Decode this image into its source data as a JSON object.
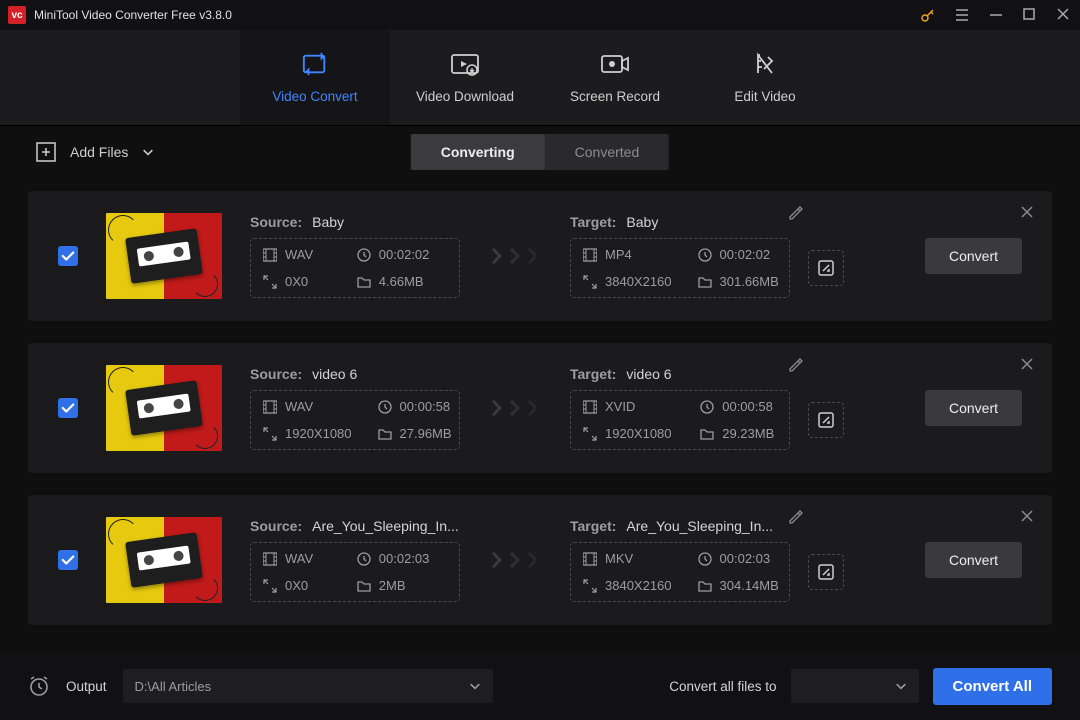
{
  "app": {
    "title": "MiniTool Video Converter Free v3.8.0"
  },
  "nav": {
    "convert": "Video Convert",
    "download": "Video Download",
    "record": "Screen Record",
    "edit": "Edit Video"
  },
  "toolbar": {
    "add_files": "Add Files"
  },
  "tabs": {
    "converting": "Converting",
    "converted": "Converted"
  },
  "labels": {
    "source": "Source:",
    "target": "Target:",
    "convert_btn": "Convert",
    "output": "Output",
    "convert_all_to": "Convert all files to",
    "convert_all": "Convert All"
  },
  "footer": {
    "output_path": "D:\\All Articles"
  },
  "items": [
    {
      "source": {
        "name": "Baby",
        "format": "WAV",
        "duration": "00:02:02",
        "resolution": "0X0",
        "size": "4.66MB"
      },
      "target": {
        "name": "Baby",
        "format": "MP4",
        "duration": "00:02:02",
        "resolution": "3840X2160",
        "size": "301.66MB"
      }
    },
    {
      "source": {
        "name": "video 6",
        "format": "WAV",
        "duration": "00:00:58",
        "resolution": "1920X1080",
        "size": "27.96MB"
      },
      "target": {
        "name": "video 6",
        "format": "XVID",
        "duration": "00:00:58",
        "resolution": "1920X1080",
        "size": "29.23MB"
      }
    },
    {
      "source": {
        "name": "Are_You_Sleeping_In...",
        "format": "WAV",
        "duration": "00:02:03",
        "resolution": "0X0",
        "size": "2MB"
      },
      "target": {
        "name": "Are_You_Sleeping_In...",
        "format": "MKV",
        "duration": "00:02:03",
        "resolution": "3840X2160",
        "size": "304.14MB"
      }
    }
  ]
}
